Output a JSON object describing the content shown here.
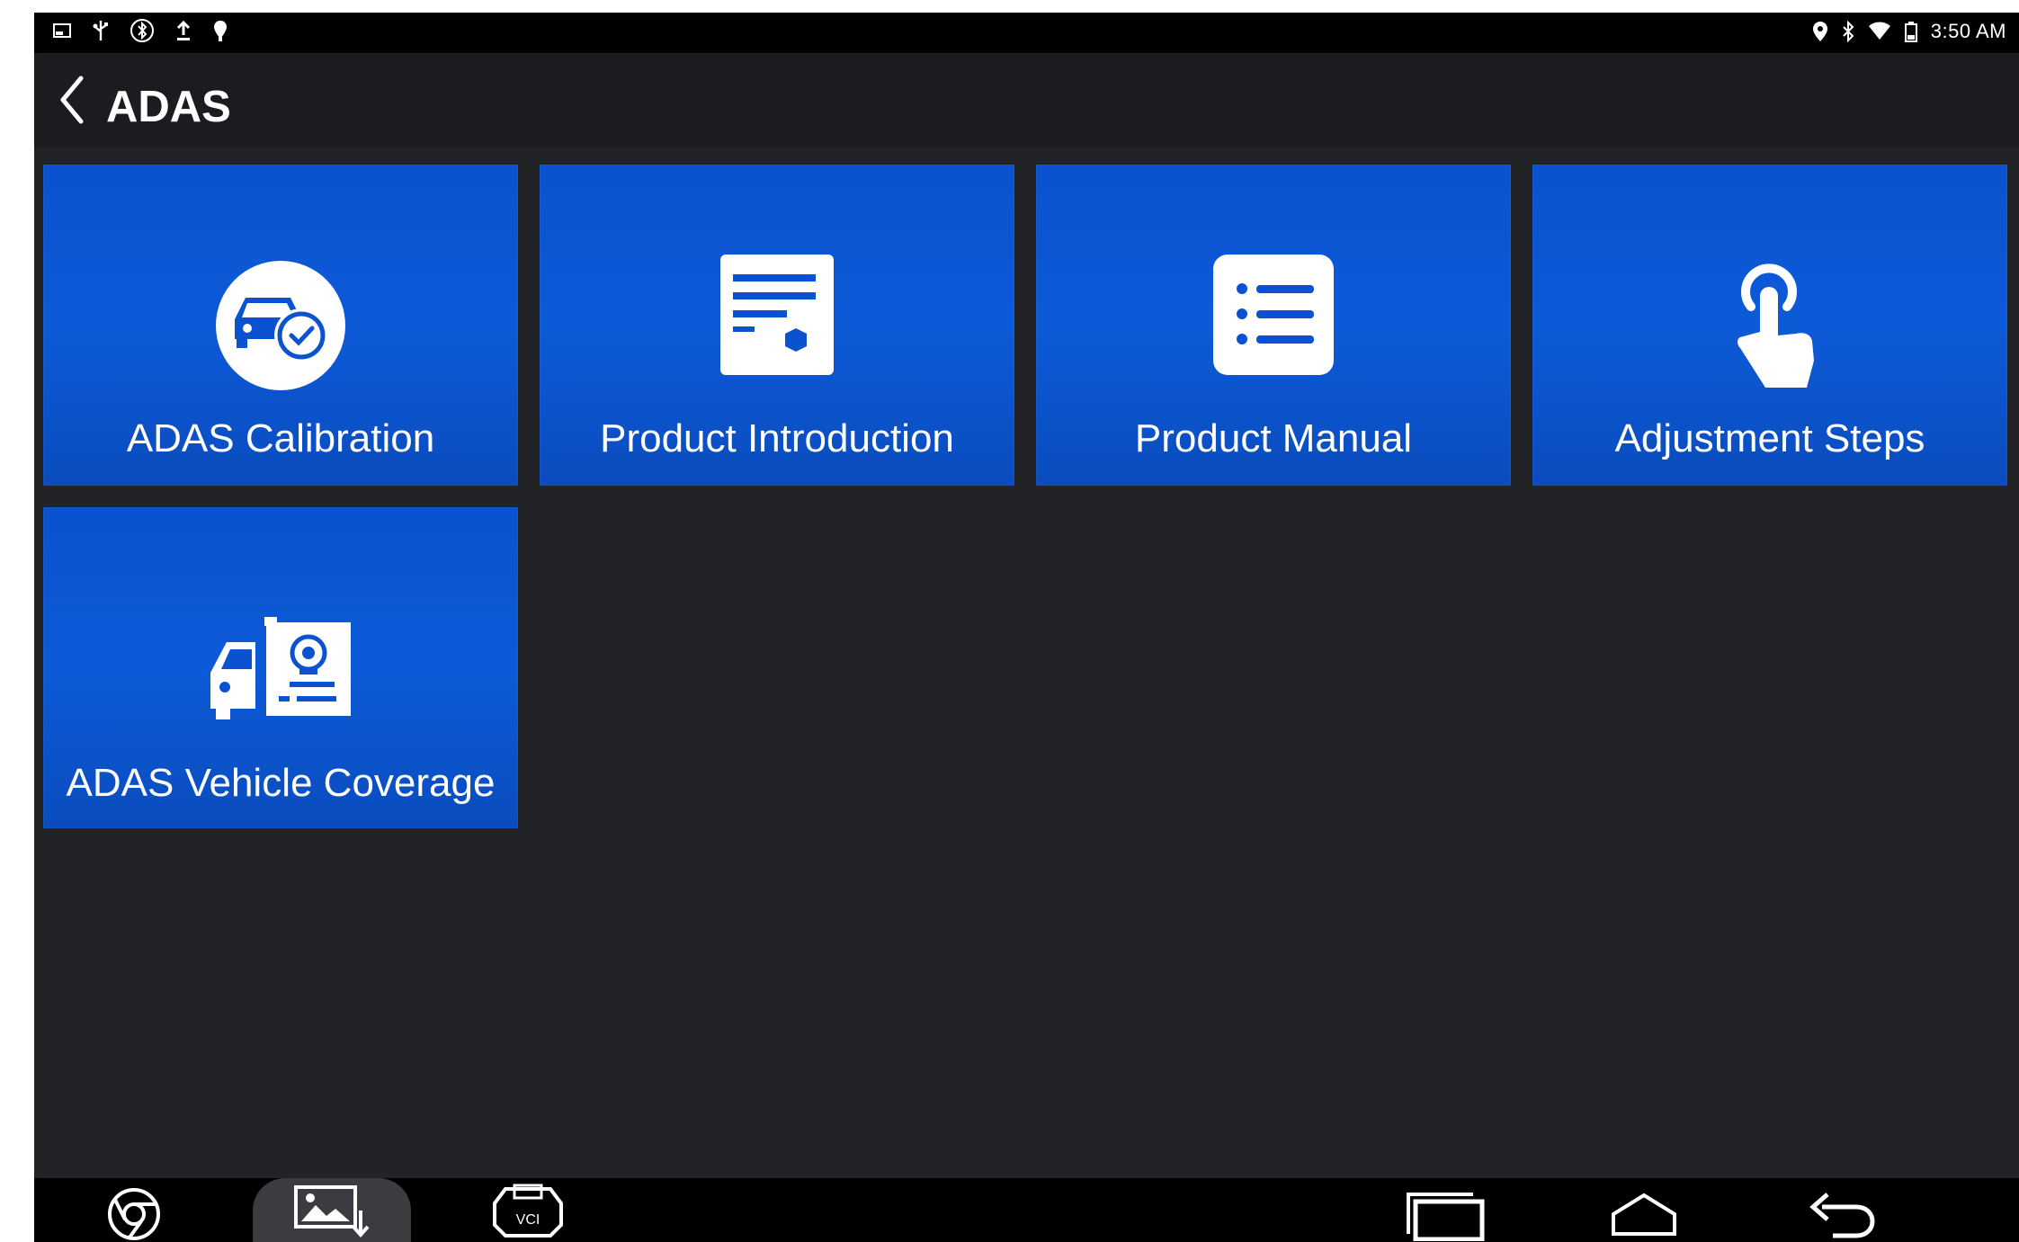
{
  "status_bar": {
    "time": "3:50 AM",
    "left_icons": [
      "screenshot-icon",
      "usb-icon",
      "bluetooth-circle-icon",
      "upload-icon",
      "location-pin-icon"
    ],
    "right_icons": [
      "location-icon",
      "bluetooth-icon",
      "wifi-icon",
      "battery-icon"
    ]
  },
  "app_bar": {
    "title": "ADAS",
    "back_icon": "chevron-left-icon"
  },
  "tiles": [
    {
      "label": "ADAS Calibration",
      "icon": "car-check-icon"
    },
    {
      "label": "Product Introduction",
      "icon": "document-icon"
    },
    {
      "label": "Product Manual",
      "icon": "list-icon"
    },
    {
      "label": "Adjustment Steps",
      "icon": "hand-tap-icon"
    },
    {
      "label": "ADAS Vehicle Coverage",
      "icon": "vehicle-coverage-icon"
    }
  ],
  "nav_bar": {
    "left": [
      "chrome-icon",
      "gallery-download-icon",
      "vci-icon"
    ],
    "right": [
      "recent-apps-icon",
      "home-icon",
      "back-icon"
    ]
  },
  "colors": {
    "background": "#222326",
    "tile": "#0a52cf",
    "status_bar": "#000000"
  }
}
